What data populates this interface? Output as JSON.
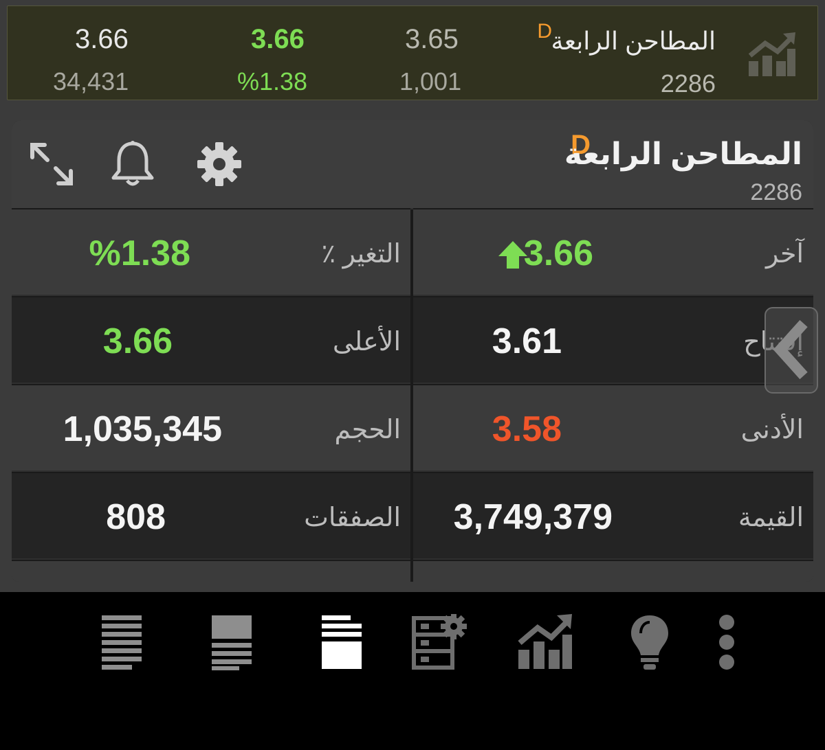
{
  "ticker": {
    "name": "المطاحن الرابعة",
    "badge": "D",
    "code": "2286",
    "bid": "3.65",
    "bid_qty": "1,001",
    "last": "3.66",
    "change_pct": "%1.38",
    "ask": "3.66",
    "ask_qty": "34,431"
  },
  "header": {
    "name": "المطاحن الرابعة",
    "badge": "D",
    "code": "2286"
  },
  "quote": {
    "last_label": "آخر",
    "last_value": "3.66",
    "change_label": "التغير ٪",
    "change_value": "%1.38",
    "open_label": "إفتتاح",
    "open_value": "3.61",
    "high_label": "الأعلى",
    "high_value": "3.66",
    "low_label": "الأدنى",
    "low_value": "3.58",
    "volume_label": "الحجم",
    "volume_value": "1,035,345",
    "turnover_label": "القيمة",
    "turnover_value": "3,749,379",
    "trades_label": "الصفقات",
    "trades_value": "808"
  },
  "colors": {
    "up": "#7edd54",
    "down": "#f0552a",
    "badge": "#f59a2e"
  },
  "nav_icons": [
    "list-icon",
    "quote-list-icon",
    "orderbook-icon",
    "portfolio-settings-icon",
    "chart-icon",
    "ideas-bulb-icon",
    "more-icon"
  ]
}
